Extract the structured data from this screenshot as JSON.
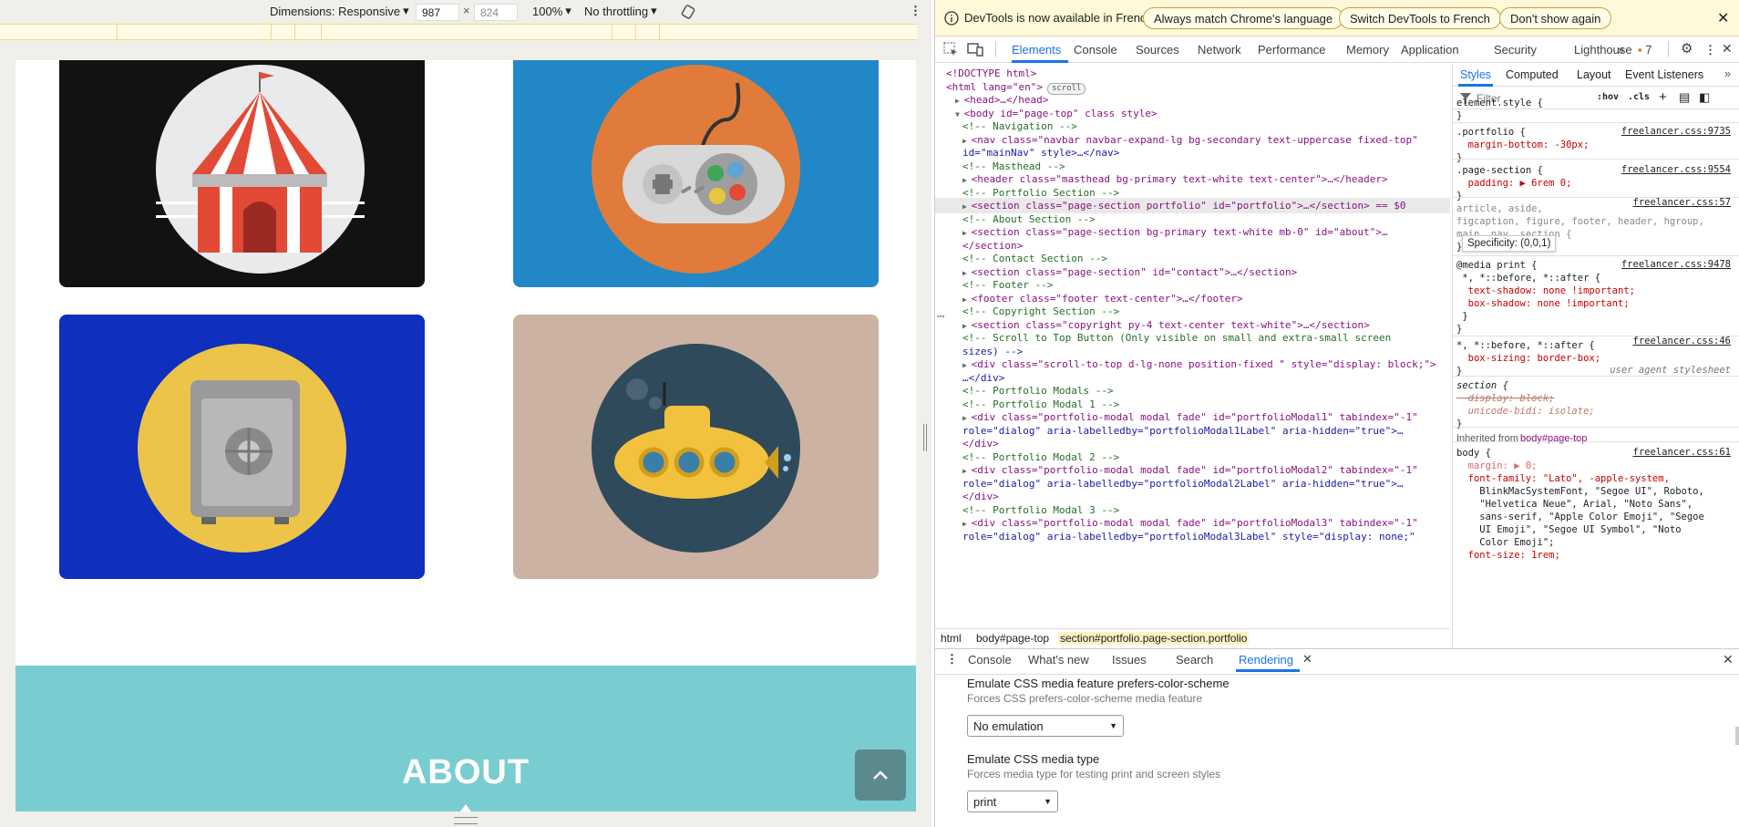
{
  "devbar": {
    "dimensions_label": "Dimensions: Responsive",
    "width": "987",
    "height": "824",
    "zoom": "100%",
    "throttle": "No throttling"
  },
  "portfolio": {
    "cards": [
      {
        "name": "circus-tent",
        "bg": "#141112",
        "circle": "#e9eaeb"
      },
      {
        "name": "game-controller",
        "bg": "#2287c6",
        "circle": "#e17b3c"
      },
      {
        "name": "safe",
        "bg": "#0f2fbd",
        "circle": "#ecc44a"
      },
      {
        "name": "submarine",
        "bg": "#cbb2a2",
        "circle": "#2f4a5a"
      }
    ]
  },
  "about": {
    "title": "ABOUT"
  },
  "infobar": {
    "message": "DevTools is now available in French!",
    "btn_match": "Always match Chrome's language",
    "btn_switch": "Switch DevTools to French",
    "btn_dismiss": "Don't show again"
  },
  "tabs": [
    "Elements",
    "Console",
    "Sources",
    "Network",
    "Performance",
    "Memory",
    "Application",
    "Security",
    "Lighthouse"
  ],
  "issues_count": "7",
  "dom_lines": [
    "<!DOCTYPE html>",
    "<html lang=\"en\">",
    "<head>…</head>",
    "<body id=\"page-top\" class style>",
    "<!-- Navigation -->",
    "<nav class=\"navbar navbar-expand-lg bg-secondary text-uppercase fixed-top\"",
    "id=\"mainNav\" style>…</nav>",
    "<!-- Masthead -->",
    "<header class=\"masthead bg-primary text-white text-center\">…</header>",
    "<!-- Portfolio Section -->",
    "<section class=\"page-section portfolio\" id=\"portfolio\">…</section> == $0",
    "<!-- About Section -->",
    "<section class=\"page-section bg-primary text-white mb-0\" id=\"about\">…",
    "</section>",
    "<!-- Contact Section -->",
    "<section class=\"page-section\" id=\"contact\">…</section>",
    "<!-- Footer -->",
    "<footer class=\"footer text-center\">…</footer>",
    "<!-- Copyright Section -->",
    "<section class=\"copyright py-4 text-center text-white\">…</section>",
    "<!-- Scroll to Top Button (Only visible on small and extra-small screen",
    "sizes) -->",
    "<div class=\"scroll-to-top d-lg-none position-fixed \" style=\"display: block;\">",
    "…</div>",
    "<!-- Portfolio Modals -->",
    "<!-- Portfolio Modal 1 -->",
    "<div class=\"portfolio-modal modal fade\" id=\"portfolioModal1\" tabindex=\"-1\"",
    "role=\"dialog\" aria-labelledby=\"portfolioModal1Label\" aria-hidden=\"true\">…",
    "</div>",
    "<!-- Portfolio Modal 2 -->",
    "<div class=\"portfolio-modal modal fade\" id=\"portfolioModal2\" tabindex=\"-1\"",
    "role=\"dialog\" aria-labelledby=\"portfolioModal2Label\" aria-hidden=\"true\">…",
    "</div>",
    "<!-- Portfolio Modal 3 -->",
    "<div class=\"portfolio-modal modal fade\" id=\"portfolioModal3\" tabindex=\"-1\"",
    "role=\"dialog\" aria-labelledby=\"portfolioModal3Label\" style=\"display: none;\""
  ],
  "html_badge": "scroll",
  "breadcrumbs": [
    "html",
    "body#page-top",
    "section#portfolio.page-section.portfolio"
  ],
  "styles": {
    "tabs": [
      "Styles",
      "Computed",
      "Layout",
      "Event Listeners"
    ],
    "filter_placeholder": "Filter",
    "hov": ":hov",
    "cls": ".cls",
    "lines": [
      "element.style {",
      "}",
      ".portfolio {",
      "  margin-bottom: -30px;",
      "}",
      ".page-section {",
      "  padding: ▶ 6rem 0;",
      "}",
      "article, aside,",
      "figcaption, figure, footer, header, hgroup,",
      "main, nav, section {",
      "}",
      "@media print {",
      " *, *::before, *::after {",
      "  text-shadow: none !important;",
      "  box-shadow: none !important;",
      " }",
      "}",
      "*, *::before, *::after {",
      "  box-sizing: border-box;",
      "}",
      "section {",
      "  display: block;",
      "  unicode-bidi: isolate;",
      "}",
      "Inherited from ",
      "body#page-top",
      "body {",
      "  margin: ▶ 0;",
      "  font-family: \"Lato\", -apple-system,",
      "    BlinkMacSystemFont, \"Segoe UI\", Roboto,",
      "    \"Helvetica Neue\", Arial, \"Noto Sans\",",
      "    sans-serif, \"Apple Color Emoji\", \"Segoe",
      "    UI Emoji\", \"Segoe UI Symbol\", \"Noto",
      "    Color Emoji\";",
      "  font-size: 1rem;"
    ],
    "sources": [
      "freelancer.css:9735",
      "freelancer.css:9554",
      "freelancer.css:57",
      "freelancer.css:9478",
      "freelancer.css:46",
      "user agent stylesheet",
      "freelancer.css:61"
    ],
    "tooltip": "Specificity: (0,0,1)"
  },
  "drawer": {
    "tabs": [
      "Console",
      "What's new",
      "Issues",
      "Search",
      "Rendering"
    ],
    "color_scheme_label": "Emulate CSS media feature prefers-color-scheme",
    "color_scheme_sub": "Forces CSS prefers-color-scheme media feature",
    "color_scheme_value": "No emulation",
    "media_type_label": "Emulate CSS media type",
    "media_type_sub": "Forces media type for testing print and screen styles",
    "media_type_value": "print"
  }
}
